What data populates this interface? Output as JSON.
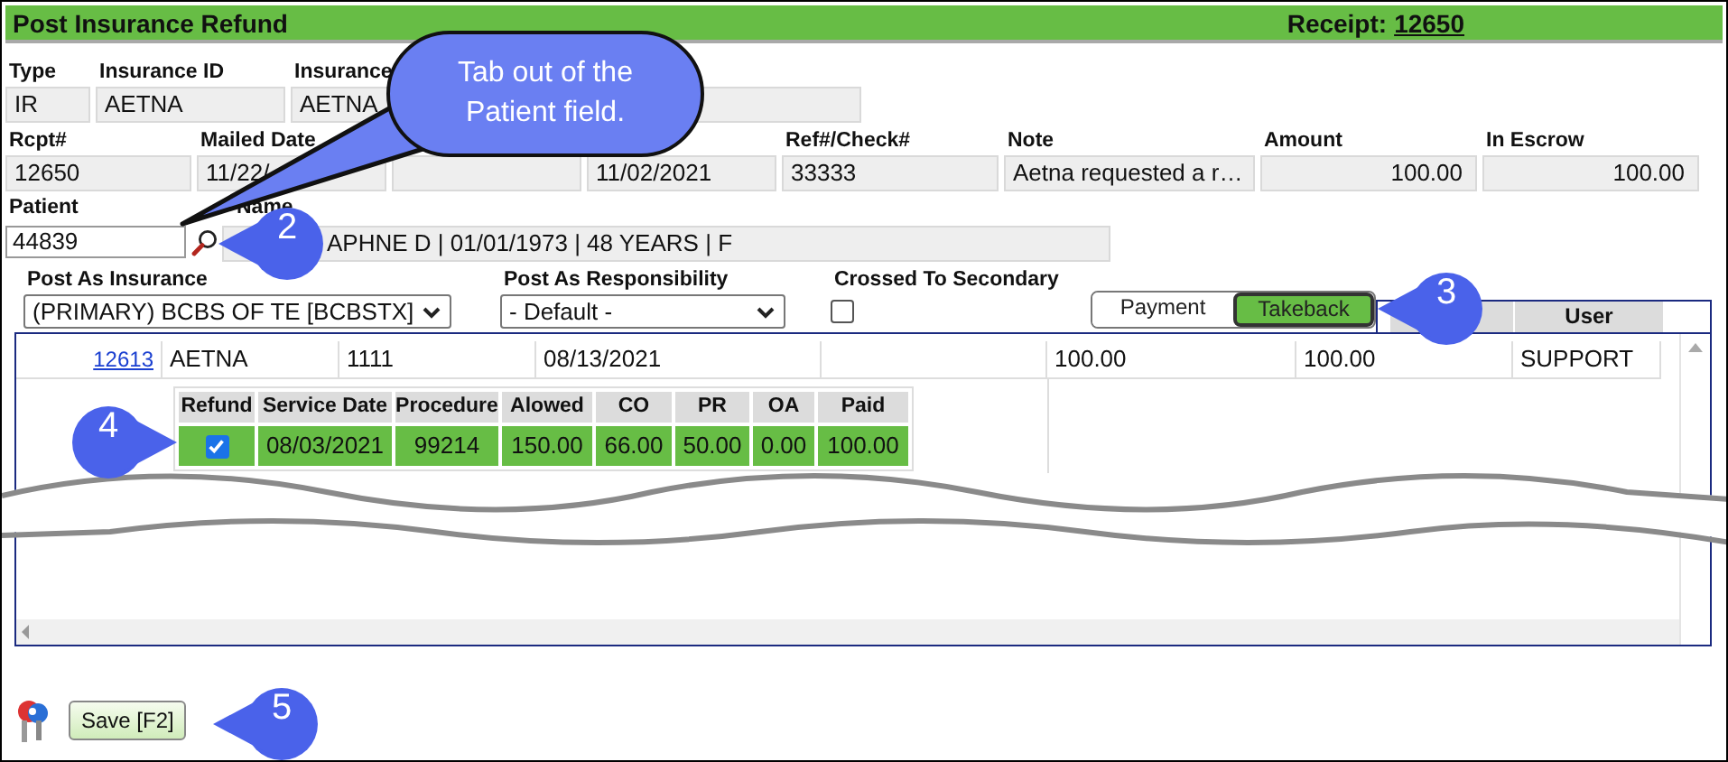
{
  "header": {
    "title": "Post Insurance Refund",
    "receipt_label": "Receipt:",
    "receipt_number": "12650"
  },
  "summary_fields": [
    {
      "kind": "text",
      "label": "Type",
      "value": "IR"
    },
    {
      "kind": "text",
      "label": "Insurance ID",
      "value": "AETNA"
    },
    {
      "kind": "text",
      "label": "Insurance",
      "value": "AETNA"
    }
  ],
  "payment_fields": [
    {
      "kind": "text",
      "label": "Rcpt#",
      "value": "12650"
    },
    {
      "kind": "text",
      "label": "Mailed Date",
      "value": "11/22/"
    },
    {
      "kind": "blank"
    },
    {
      "kind": "text",
      "value": "11/02/2021"
    },
    {
      "kind": "text",
      "label": "Ref#/Check#",
      "value": "33333"
    },
    {
      "kind": "text",
      "label": "Note",
      "value": "Aetna requested a r…"
    },
    {
      "kind": "number",
      "label": "Amount",
      "value": "100.00"
    },
    {
      "kind": "number",
      "label": "In Escrow",
      "value": "100.00"
    }
  ],
  "patient": {
    "label": "Patient",
    "value": "44839",
    "name_label": "Name",
    "name_value": "APHNE D | 01/01/1973 | 48 YEARS | F"
  },
  "post_as_insurance": {
    "label": "Post As Insurance",
    "value": "(PRIMARY) BCBS OF TE [BCBSTX]"
  },
  "post_as_responsibility": {
    "label": "Post As Responsibility",
    "value": "- Default -"
  },
  "crossed_to_secondary": {
    "label": "Crossed To Secondary",
    "checked": false
  },
  "mode_buttons": [
    {
      "label": "Payment",
      "selected": false
    },
    {
      "label": "Takeback",
      "selected": true
    }
  ],
  "grid": {
    "user_column": "User",
    "rows": [
      {
        "cells": [
          {
            "kind": "link",
            "text": "12613"
          },
          {
            "kind": "text",
            "text": "AETNA"
          },
          {
            "kind": "text",
            "text": "1111"
          },
          {
            "kind": "text",
            "text": "08/13/2021"
          },
          {
            "kind": "blank"
          },
          {
            "kind": "text",
            "text": "100.00"
          },
          {
            "kind": "text",
            "text": "100.00"
          },
          {
            "kind": "text",
            "text": "SUPPORT"
          }
        ]
      }
    ]
  },
  "lines": {
    "columns": [
      "Refund",
      "Service Date",
      "Procedure",
      "Alowed",
      "CO",
      "PR",
      "OA",
      "Paid"
    ],
    "rows": [
      {
        "cells": [
          {
            "kind": "checkbox",
            "checked": true
          },
          {
            "kind": "text",
            "text": "08/03/2021"
          },
          {
            "kind": "text",
            "text": "99214"
          },
          {
            "kind": "text",
            "text": "150.00"
          },
          {
            "kind": "text",
            "text": "66.00"
          },
          {
            "kind": "text",
            "text": "50.00"
          },
          {
            "kind": "text",
            "text": "0.00"
          },
          {
            "kind": "text",
            "text": "100.00"
          }
        ]
      }
    ]
  },
  "footer_buttons": [
    {
      "label": "Save [F2]"
    }
  ],
  "callouts": [
    {
      "kind": "bubble",
      "text": "Tab out of the Patient field."
    },
    {
      "kind": "marker",
      "text": "2"
    },
    {
      "kind": "marker",
      "text": "3"
    },
    {
      "kind": "marker",
      "text": "4"
    },
    {
      "kind": "marker",
      "text": "5"
    }
  ]
}
